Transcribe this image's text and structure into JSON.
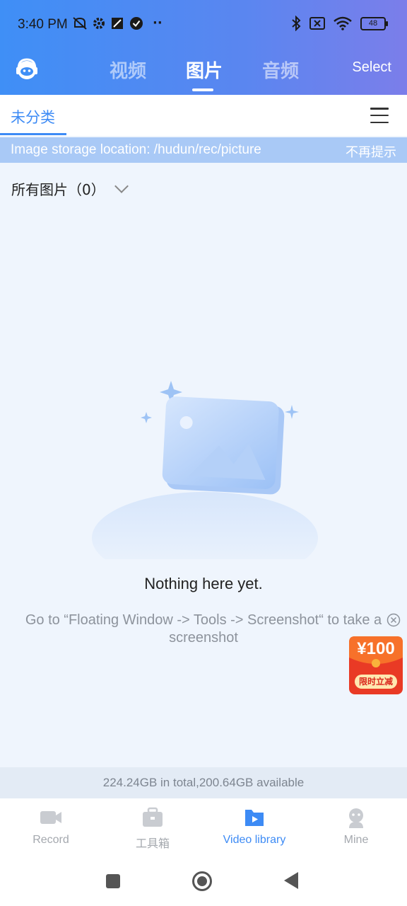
{
  "status_bar": {
    "time": "3:40 PM",
    "battery": "48"
  },
  "top_nav": {
    "tabs": [
      {
        "label": "视频",
        "active": false
      },
      {
        "label": "图片",
        "active": true
      },
      {
        "label": "音频",
        "active": false
      }
    ],
    "select_label": "Select"
  },
  "category": {
    "active_tab": "未分类"
  },
  "notice": {
    "text": "Image storage location: /hudun/rec/picture",
    "dismiss": "不再提示"
  },
  "filter": {
    "label": "所有图片（0）"
  },
  "empty_state": {
    "title": "Nothing here yet.",
    "hint": "Go to “Floating Window -> Tools -> Screenshot“ to take a screenshot"
  },
  "promo": {
    "amount": "¥100",
    "label": "限时立减"
  },
  "storage": {
    "text": "224.24GB in total,200.64GB available"
  },
  "bottom_nav": [
    {
      "label": "Record",
      "icon": "camera-icon",
      "active": false
    },
    {
      "label": "工具箱",
      "icon": "toolbox-icon",
      "active": false
    },
    {
      "label": "Video library",
      "icon": "video-library-icon",
      "active": true
    },
    {
      "label": "Mine",
      "icon": "user-icon",
      "active": false
    }
  ],
  "colors": {
    "accent": "#3d8bf5",
    "header_start": "#3f8ff6",
    "header_end": "#7b7eea",
    "notice_bg": "#a9c9f6"
  }
}
